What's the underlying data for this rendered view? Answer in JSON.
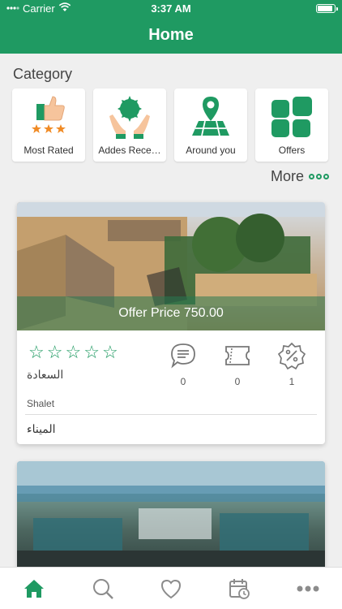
{
  "status_bar": {
    "carrier": "Carrier",
    "time": "3:37 AM"
  },
  "header": {
    "title": "Home"
  },
  "category": {
    "title": "Category",
    "items": [
      {
        "label": "Most Rated",
        "icon": "thumbs-up-rating-icon"
      },
      {
        "label": "Addes Rece…",
        "icon": "hands-badge-icon"
      },
      {
        "label": "Around you",
        "icon": "map-pin-icon"
      },
      {
        "label": "Offers",
        "icon": "grid-icon"
      }
    ],
    "more_label": "More"
  },
  "listings": [
    {
      "offer_text": "Offer Price 750.00",
      "stars": 5,
      "name_ar": "السعادة",
      "comments_count": "0",
      "tickets_count": "0",
      "discount_count": "1",
      "type": "Shalet",
      "area_ar": "الميناء"
    }
  ],
  "tabbar": {
    "items": [
      {
        "icon": "home-icon",
        "active": true
      },
      {
        "icon": "search-icon",
        "active": false
      },
      {
        "icon": "heart-icon",
        "active": false
      },
      {
        "icon": "calendar-icon",
        "active": false
      },
      {
        "icon": "more-icon",
        "active": false
      }
    ]
  },
  "colors": {
    "accent": "#1f9a62",
    "background": "#efefef"
  }
}
